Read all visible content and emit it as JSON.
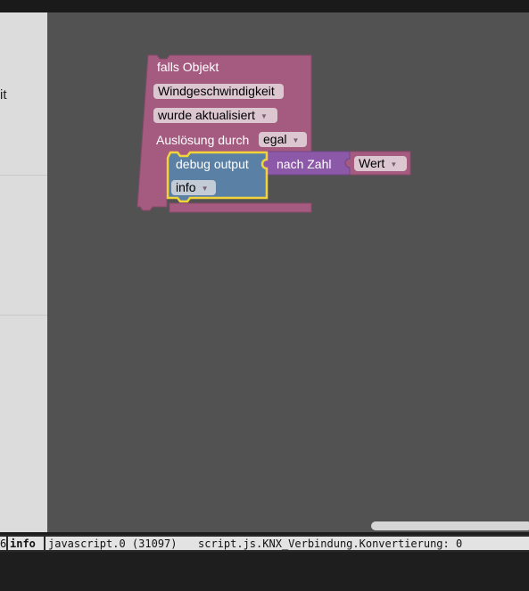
{
  "sidebar": {
    "visible_text": "it"
  },
  "blocks": {
    "trigger": {
      "title": "falls Objekt",
      "object": "Windgeschwindigkeit",
      "condition": "wurde aktualisiert",
      "ack_label": "Auslösung durch",
      "ack_value": "egal",
      "color": "#a55b80"
    },
    "debug": {
      "label": "debug output",
      "level": "info",
      "color": "#5b80a5"
    },
    "to_number": {
      "label": "nach Zahl",
      "color": "#8c58a8"
    },
    "value": {
      "field": "Wert",
      "color": "#a55b80"
    }
  },
  "log": {
    "prefix": "6",
    "level": "info",
    "source": "javascript.0 (31097)",
    "message": "script.js.KNX_Verbindung.Konvertierung: 0"
  }
}
